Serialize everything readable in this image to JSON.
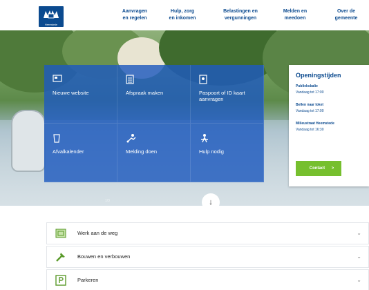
{
  "header": {
    "logo_caption": "Heemstede",
    "nav": [
      {
        "line1": "Aanvragen",
        "line2": "en regelen"
      },
      {
        "line1": "Hulp, zorg",
        "line2": "en inkomen"
      },
      {
        "line1": "Belastingen en",
        "line2": "vergunningen"
      },
      {
        "line1": "Melden en",
        "line2": "meedoen"
      },
      {
        "line1": "Over de",
        "line2": "gemeente"
      }
    ]
  },
  "tiles": [
    {
      "label": "Nieuwe website",
      "icon": "monitor-icon"
    },
    {
      "label": "Afspraak maken",
      "icon": "calendar-icon"
    },
    {
      "label": "Paspoort of ID kaart aanvragen",
      "icon": "passport-icon"
    },
    {
      "label": "Afvalkalender",
      "icon": "trash-bin-icon"
    },
    {
      "label": "Melding doen",
      "icon": "report-person-icon"
    },
    {
      "label": "Hulp nodig",
      "icon": "people-help-icon"
    }
  ],
  "tiles_counter": "1/3",
  "hours": {
    "title": "Openingstijden",
    "items": [
      {
        "name": "Publieksbalie",
        "time": "Vandaag tot 17:00"
      },
      {
        "name": "Bellen naar loket",
        "time": "Vandaag tot 17:00"
      },
      {
        "name": "Milieustraat Heemstede",
        "time": "Vandaag tot 16:30"
      }
    ],
    "contact_label": "Contact",
    "contact_arrow": ">"
  },
  "scroll_arrow": "↓",
  "accordion": [
    {
      "label": "Werk aan de weg",
      "icon": "road-sign-icon"
    },
    {
      "label": "Bouwen en verbouwen",
      "icon": "hammer-icon"
    },
    {
      "label": "Parkeren",
      "icon": "parking-icon"
    }
  ],
  "chevron": "⌄",
  "colors": {
    "brand_blue": "#0b4a8f",
    "tile_blue": "#1e5abe",
    "accent_green": "#76bf2e"
  }
}
